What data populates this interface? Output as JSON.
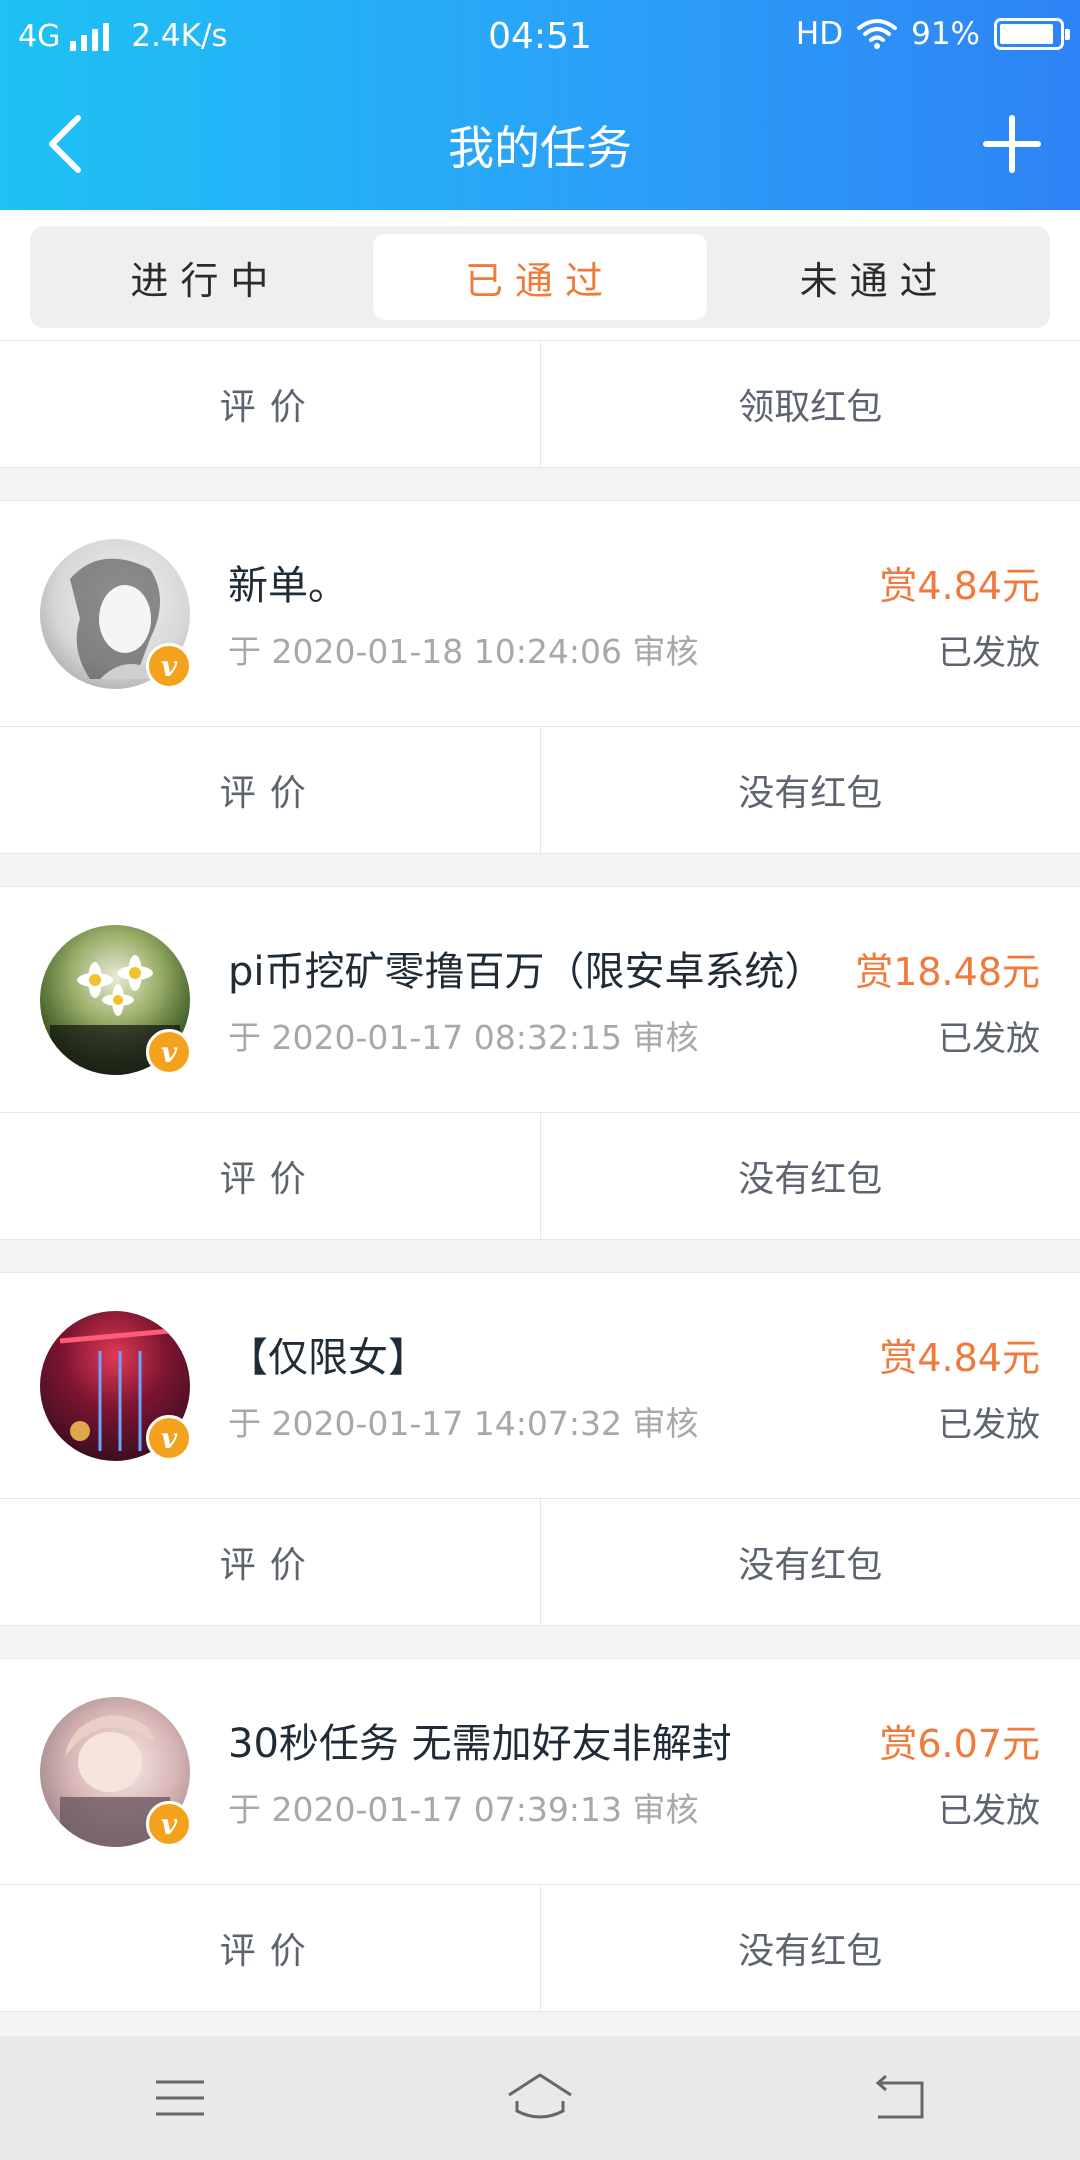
{
  "status_bar": {
    "network": "4G",
    "speed": "2.4K/s",
    "time": "04:51",
    "hd": "HD",
    "battery": "91%",
    "battery_level": 0.91
  },
  "header": {
    "title": "我的任务"
  },
  "tabs": [
    {
      "label": "进行中",
      "active": false
    },
    {
      "label": "已通过",
      "active": true
    },
    {
      "label": "未通过",
      "active": false
    }
  ],
  "top_actions": {
    "rate": "评价",
    "redpacket": "领取红包"
  },
  "tasks": [
    {
      "title": "新单。",
      "date": "于 2020-01-18 10:24:06 审核",
      "reward": "赏4.84元",
      "status": "已发放",
      "badge": "v",
      "rate_label": "评价",
      "redpacket_label": "没有红包"
    },
    {
      "title": "pi币挖矿零撸百万（限安卓系统）",
      "date": "于 2020-01-17 08:32:15 审核",
      "reward": "赏18.48元",
      "status": "已发放",
      "badge": "v",
      "rate_label": "评价",
      "redpacket_label": "没有红包"
    },
    {
      "title": "【仅限女】",
      "date": "于 2020-01-17 14:07:32 审核",
      "reward": "赏4.84元",
      "status": "已发放",
      "badge": "v",
      "rate_label": "评价",
      "redpacket_label": "没有红包"
    },
    {
      "title": "30秒任务 无需加好友非解封",
      "date": "于 2020-01-17 07:39:13 审核",
      "reward": "赏6.07元",
      "status": "已发放",
      "badge": "v",
      "rate_label": "评价",
      "redpacket_label": "没有红包"
    }
  ],
  "colors": {
    "accent": "#ef7a3c",
    "header_start": "#1ec2f4",
    "header_end": "#2e83f6",
    "badge": "#f4a21e"
  },
  "icons": {
    "back": "chevron-left-icon",
    "add": "plus-icon",
    "menu": "menu-icon",
    "home": "home-icon",
    "return": "return-icon"
  }
}
